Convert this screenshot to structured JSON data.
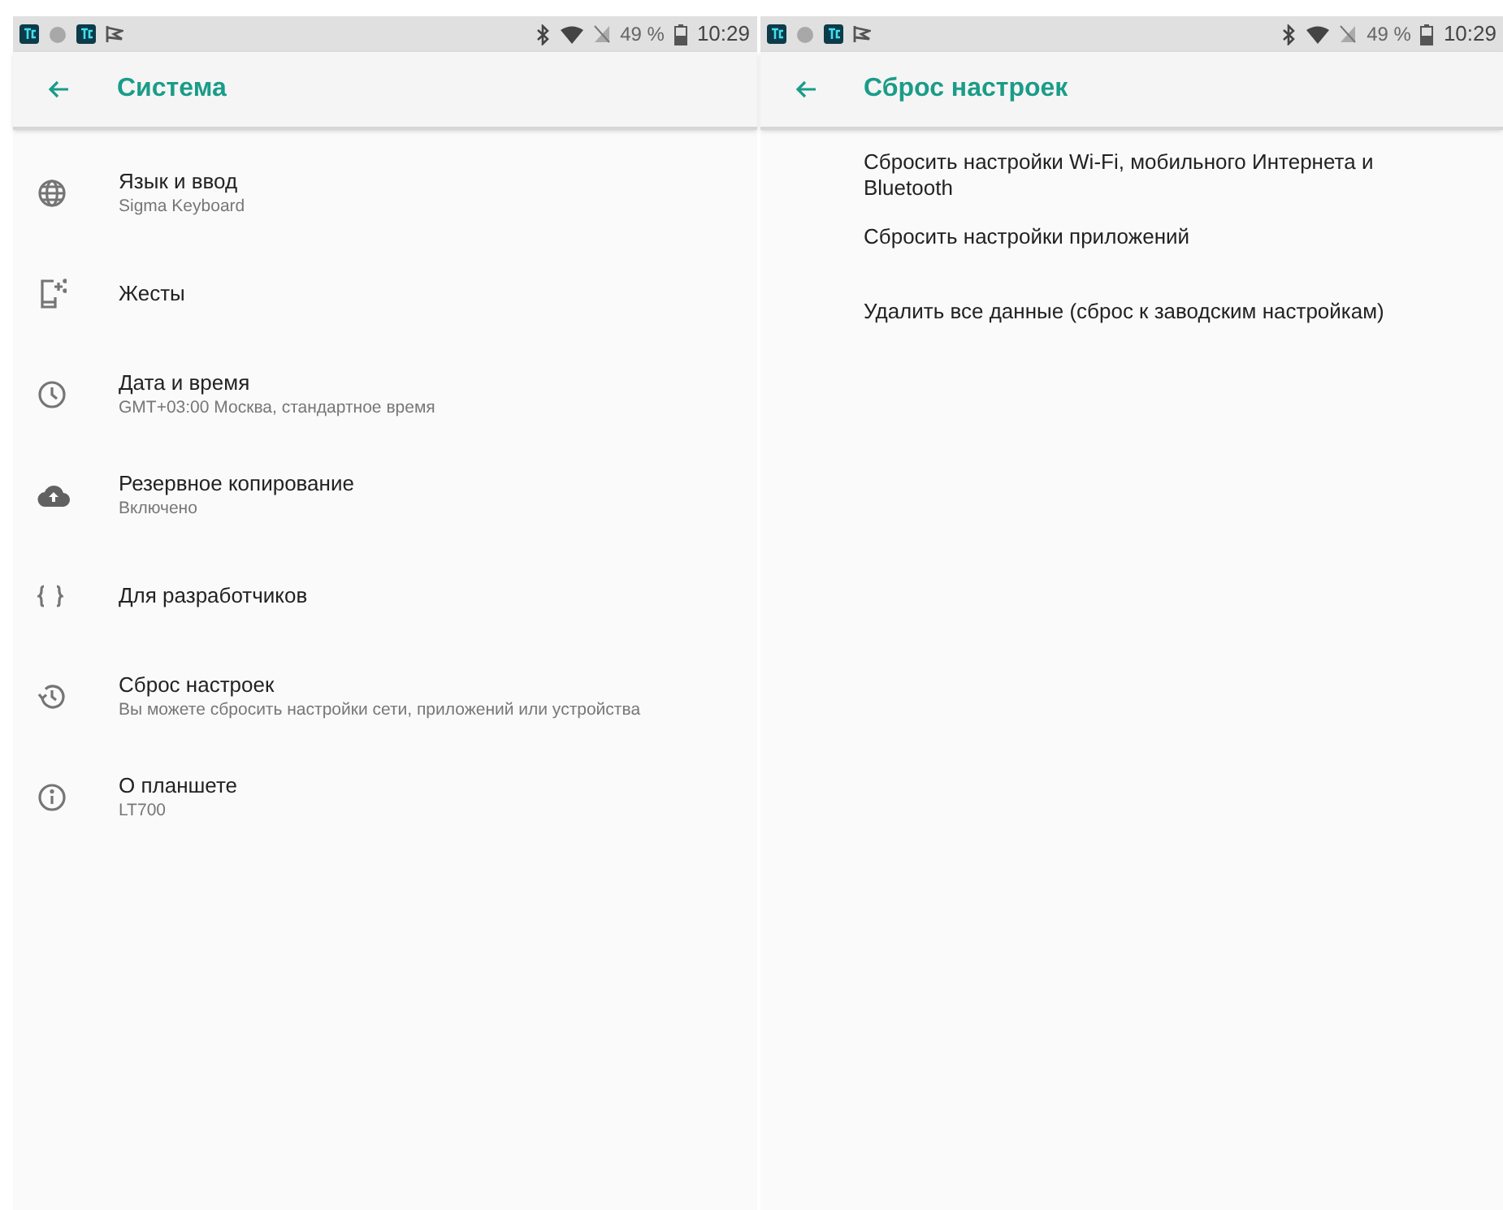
{
  "screens": [
    {
      "kind": "icon-list",
      "status_bar": {
        "battery": "49 %",
        "time": "10:29"
      },
      "title": "Система",
      "items": [
        {
          "title": "Язык и ввод",
          "subtitle": "Sigma Keyboard"
        },
        {
          "title": "Жесты"
        },
        {
          "title": "Дата и время",
          "subtitle": "GMT+03:00 Москва, стандартное время"
        },
        {
          "title": "Резервное копирование",
          "subtitle": "Включено"
        },
        {
          "title": "Для разработчиков"
        },
        {
          "title": "Сброс настроек",
          "subtitle": "Вы можете сбросить настройки сети, приложений или устройства"
        },
        {
          "title": "О планшете",
          "subtitle": "LT700"
        }
      ]
    },
    {
      "kind": "plain-list",
      "status_bar": {
        "battery": "49 %",
        "time": "10:29"
      },
      "title": "Сброс настроек",
      "items": [
        {
          "title": "Сбросить настройки Wi-Fi, мобильного Интернета и Bluetooth"
        },
        {
          "title": "Сбросить настройки приложений"
        },
        {
          "title": "Удалить все данные (сброс к заводским настройкам)"
        }
      ]
    }
  ]
}
